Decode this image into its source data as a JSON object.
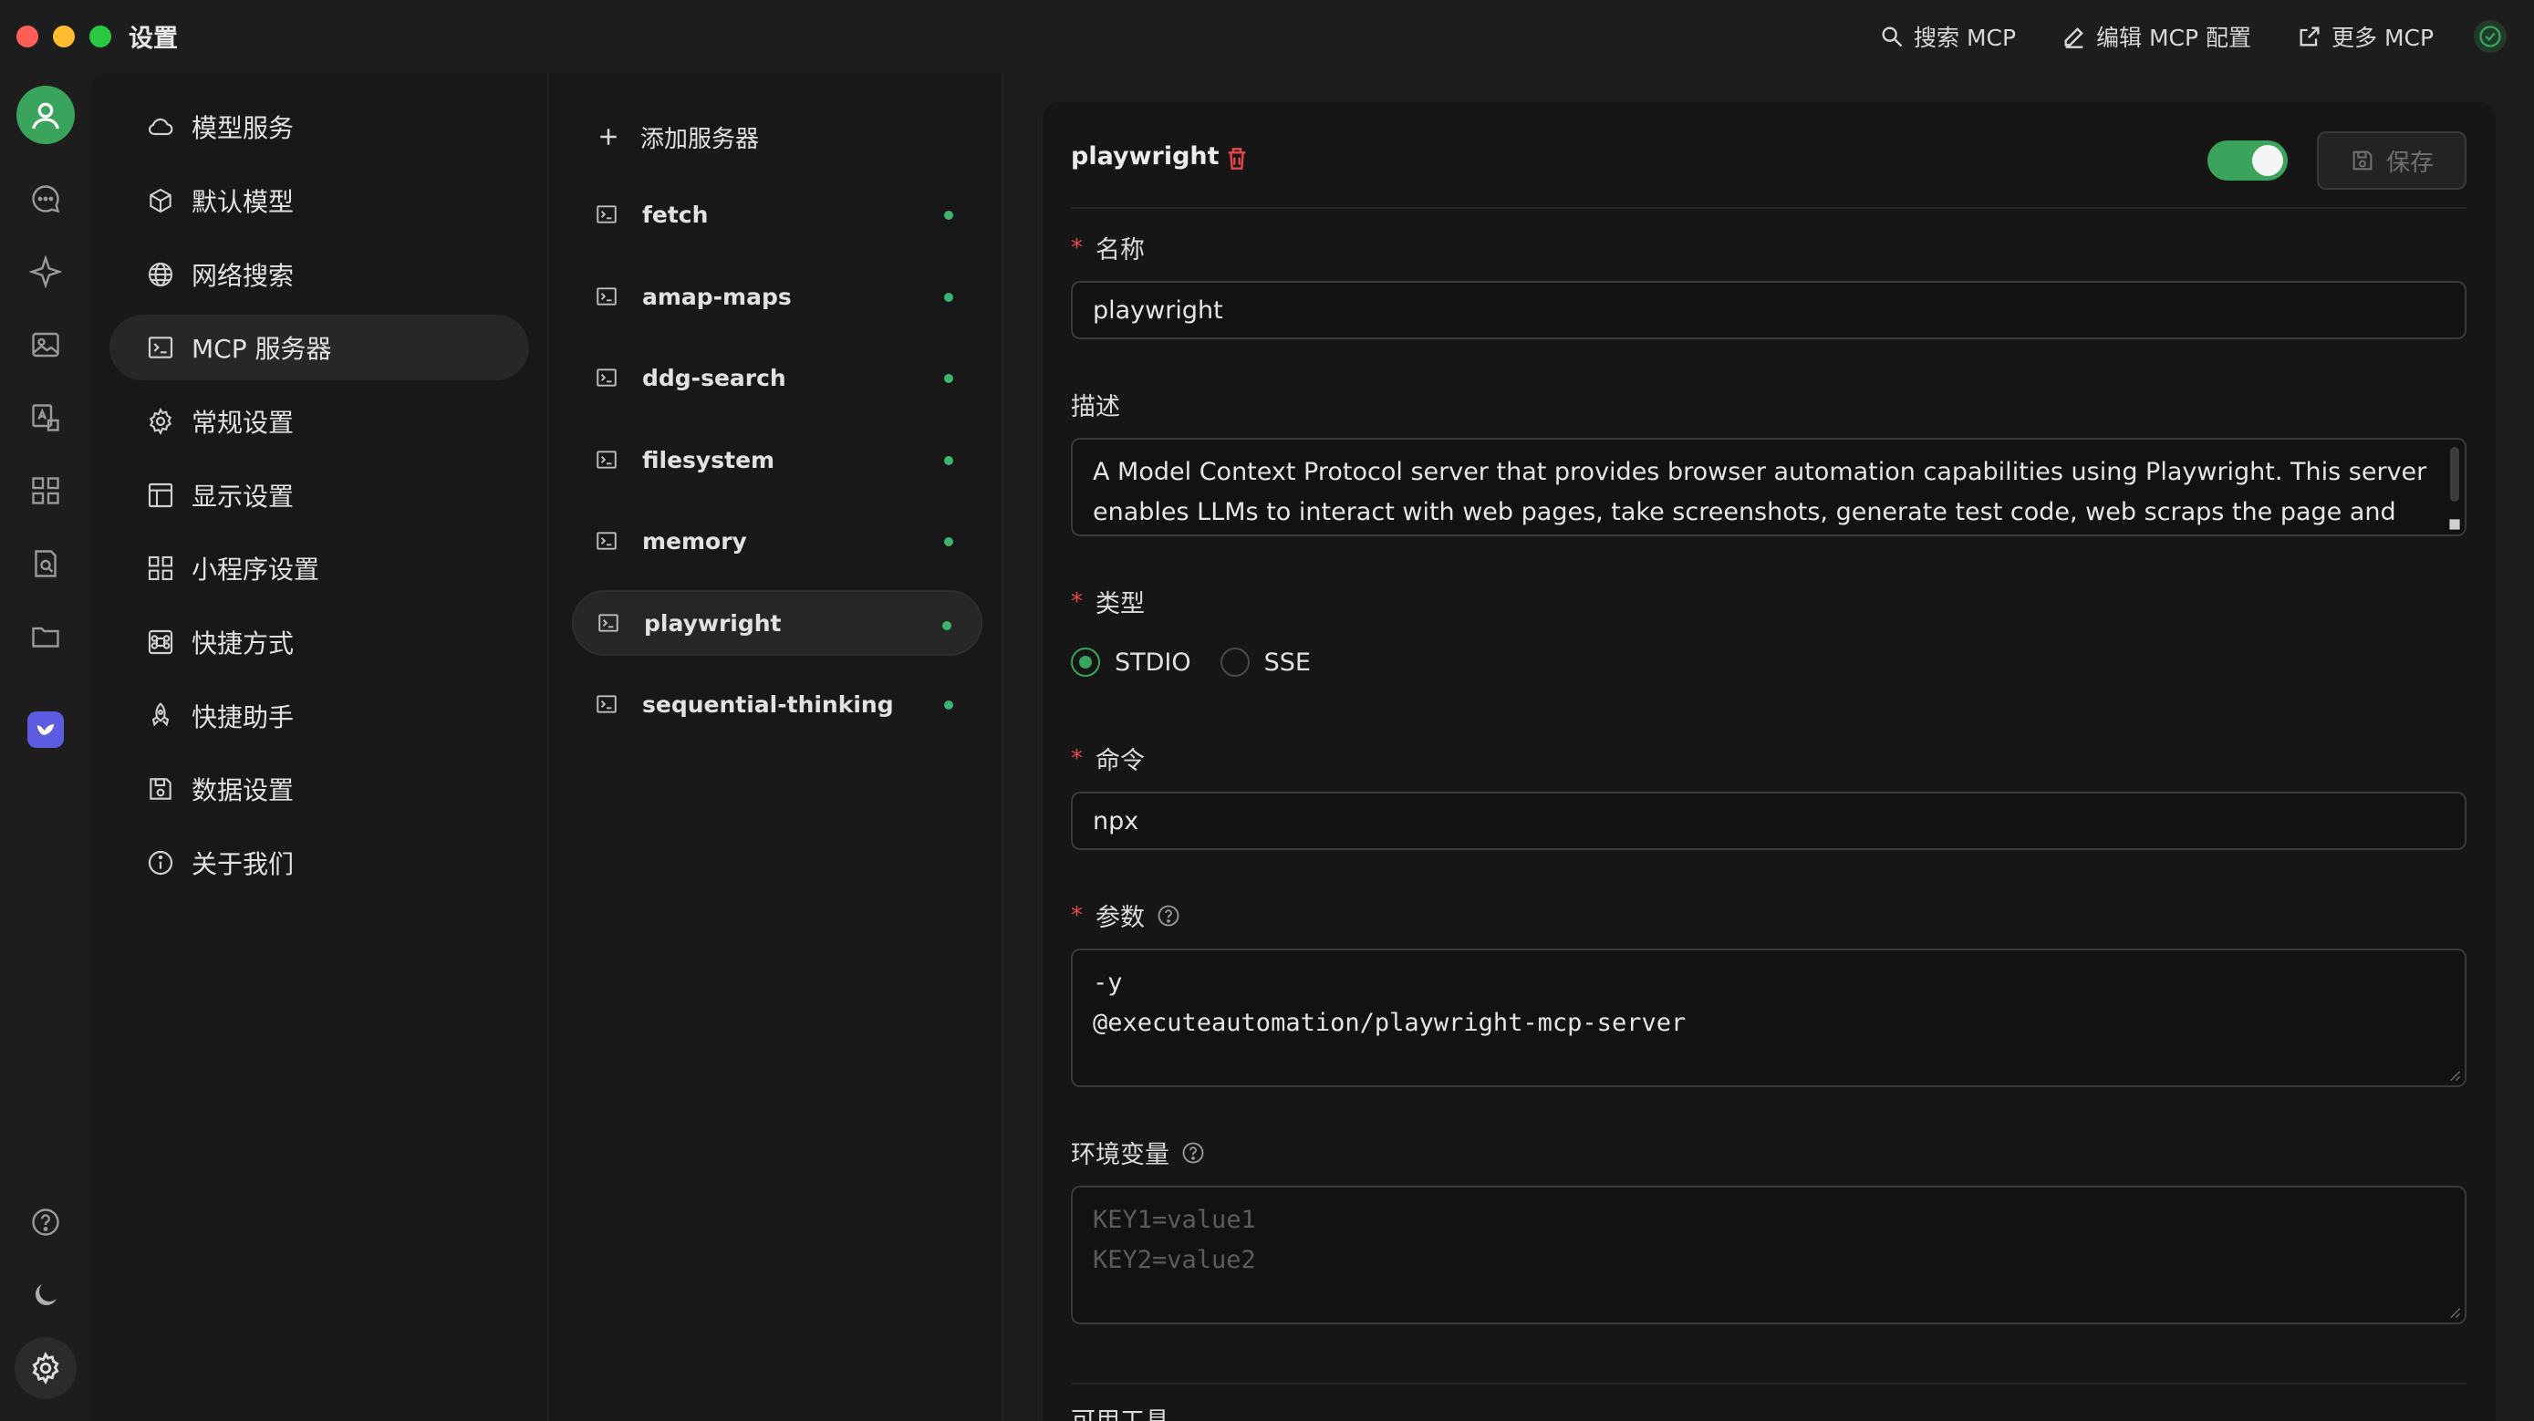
{
  "window": {
    "title": "设置"
  },
  "toolbar": {
    "search_label": "搜索 MCP",
    "edit_label": "编辑 MCP 配置",
    "more_label": "更多 MCP"
  },
  "nav": {
    "items": [
      {
        "label": "模型服务",
        "icon": "cloud-icon"
      },
      {
        "label": "默认模型",
        "icon": "cube-icon"
      },
      {
        "label": "网络搜索",
        "icon": "globe-icon"
      },
      {
        "label": "MCP 服务器",
        "icon": "terminal-icon",
        "active": true
      },
      {
        "label": "常规设置",
        "icon": "gear-icon"
      },
      {
        "label": "显示设置",
        "icon": "layout-icon"
      },
      {
        "label": "小程序设置",
        "icon": "grid-icon"
      },
      {
        "label": "快捷方式",
        "icon": "command-icon"
      },
      {
        "label": "快捷助手",
        "icon": "rocket-icon"
      },
      {
        "label": "数据设置",
        "icon": "save-icon"
      },
      {
        "label": "关于我们",
        "icon": "info-icon"
      }
    ]
  },
  "servers": {
    "add_label": "添加服务器",
    "items": [
      {
        "name": "fetch",
        "status": "active"
      },
      {
        "name": "amap-maps",
        "status": "active"
      },
      {
        "name": "ddg-search",
        "status": "active"
      },
      {
        "name": "filesystem",
        "status": "active"
      },
      {
        "name": "memory",
        "status": "active"
      },
      {
        "name": "playwright",
        "status": "active",
        "selected": true
      },
      {
        "name": "sequential-thinking",
        "status": "active"
      }
    ]
  },
  "detail": {
    "title": "playwright",
    "enabled": true,
    "save_label": "保存",
    "name_label": "名称",
    "name_value": "playwright",
    "desc_label": "描述",
    "desc_value": "A Model Context Protocol server that provides browser automation capabilities using Playwright. This server enables LLMs to interact with web pages, take screenshots, generate test code, web scraps the page and",
    "type_label": "类型",
    "type_options": [
      "STDIO",
      "SSE"
    ],
    "type_selected": "STDIO",
    "command_label": "命令",
    "command_value": "npx",
    "args_label": "参数",
    "args_lines": [
      "-y",
      "@executeautomation/playwright-mcp-server"
    ],
    "env_label": "环境变量",
    "env_placeholder": [
      "KEY1=value1",
      "KEY2=value2"
    ],
    "tools_label": "可用工具"
  },
  "colors": {
    "accent": "#3aa35c",
    "danger": "#e5484d",
    "status_dot": "#3cb371"
  }
}
